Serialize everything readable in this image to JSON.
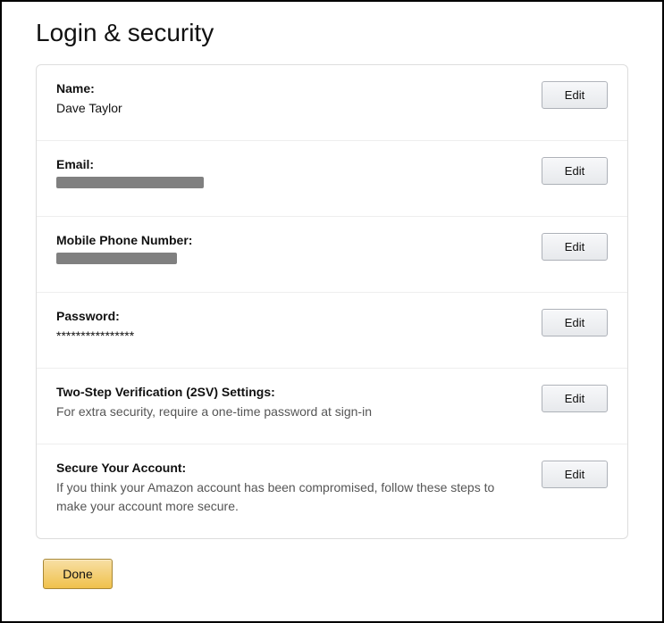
{
  "page_title": "Login & security",
  "rows": {
    "name": {
      "label": "Name:",
      "value": "Dave Taylor",
      "edit": "Edit"
    },
    "email": {
      "label": "Email:",
      "edit": "Edit"
    },
    "phone": {
      "label": "Mobile Phone Number:",
      "edit": "Edit"
    },
    "password": {
      "label": "Password:",
      "value": "****************",
      "edit": "Edit"
    },
    "twostep": {
      "label": "Two-Step Verification (2SV) Settings:",
      "desc": "For extra security, require a one-time password at sign-in",
      "edit": "Edit"
    },
    "secure": {
      "label": "Secure Your Account:",
      "desc": "If you think your Amazon account has been compromised, follow these steps to make your account more secure.",
      "edit": "Edit"
    }
  },
  "done_label": "Done"
}
